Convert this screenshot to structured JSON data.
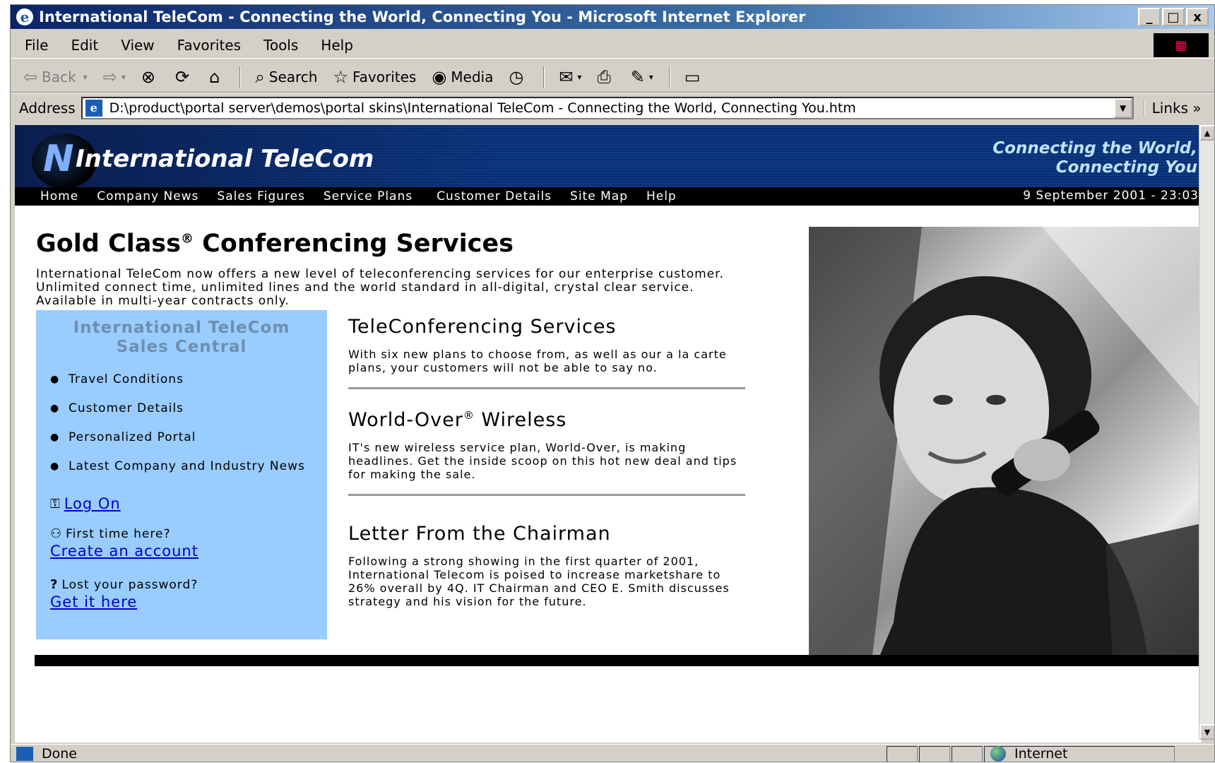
{
  "window": {
    "title": "International TeleCom - Connecting the World, Connecting You - Microsoft Internet Explorer",
    "controls": {
      "minimize": "_",
      "maximize": "□",
      "close": "x"
    }
  },
  "menubar": {
    "items": [
      "File",
      "Edit",
      "View",
      "Favorites",
      "Tools",
      "Help"
    ]
  },
  "toolbar": {
    "back": "Back",
    "search": "Search",
    "favorites": "Favorites",
    "media": "Media"
  },
  "address": {
    "label": "Address",
    "value": "D:\\product\\portal server\\demos\\portal skins\\International TeleCom - Connecting the World, Connecting You.htm",
    "links_label": "Links"
  },
  "site": {
    "brand": "International TeleCom",
    "tagline_line1": "Connecting the World,",
    "tagline_line2": "Connecting You",
    "nav": [
      "Home",
      "Company News",
      "Sales Figures",
      "Service Plans",
      "Customer Details",
      "Site Map",
      "Help"
    ],
    "datetime": "9 September 2001 - 23:03"
  },
  "main": {
    "title": "Gold Class",
    "title_mark": "®",
    "title_rest": " Conferencing Services",
    "intro": "International TeleCom now offers a new level of teleconferencing services for our enterprise customer. Unlimited connect time, unlimited lines and the world standard in all-digital, crystal clear service. Available in multi-year contracts only."
  },
  "sidebar": {
    "title_line1": "International TeleCom",
    "title_line2": "Sales Central",
    "items": [
      "Travel Conditions",
      "Customer Details",
      "Personalized Portal",
      "Latest Company and Industry News"
    ],
    "logon_link": "Log On",
    "first_time_text": "First time here?",
    "create_link": "Create an account",
    "lost_text": "Lost your password?",
    "get_link": "Get it here"
  },
  "sections": [
    {
      "title": "TeleConferencing Services",
      "body": "With six new plans to choose from, as well as our a la carte plans, your customers will not be able to say no."
    },
    {
      "title": "World-Over",
      "title_mark": "®",
      "title_rest": " Wireless",
      "body": "IT's new wireless service plan, World-Over, is making headlines. Get the inside scoop on this hot new deal and tips for making the sale."
    },
    {
      "title": "Letter From the Chairman",
      "body": "Following a strong showing in the first quarter of 2001, International Telecom is poised to increase marketshare to 26% overall by 4Q. IT Chairman and CEO E. Smith discusses strategy and his vision for the future."
    }
  ],
  "statusbar": {
    "status": "Done",
    "zone": "Internet"
  }
}
